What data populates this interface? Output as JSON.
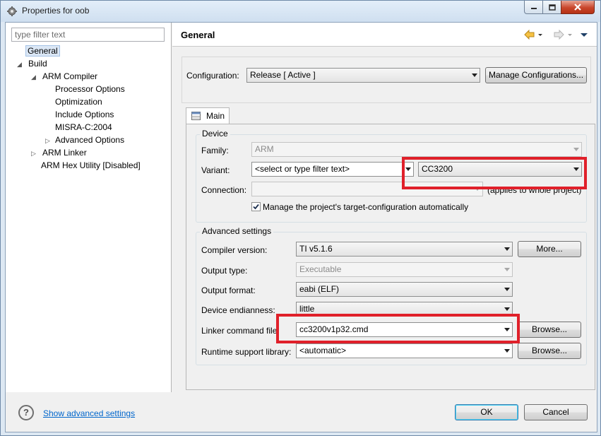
{
  "window": {
    "title": "Properties for oob"
  },
  "left": {
    "filter_placeholder": "type filter text",
    "tree": [
      {
        "label": "General"
      },
      {
        "label": "Build"
      },
      {
        "label": "ARM Compiler"
      },
      {
        "label": "Processor Options"
      },
      {
        "label": "Optimization"
      },
      {
        "label": "Include Options"
      },
      {
        "label": "MISRA-C:2004"
      },
      {
        "label": "Advanced Options"
      },
      {
        "label": "ARM Linker"
      },
      {
        "label": "ARM Hex Utility  [Disabled]"
      }
    ]
  },
  "header": {
    "title": "General"
  },
  "configuration": {
    "label": "Configuration:",
    "value": "Release  [ Active ]",
    "manage_button": "Manage Configurations..."
  },
  "tab": {
    "label": "Main"
  },
  "device": {
    "group_title": "Device",
    "family_label": "Family:",
    "family_value": "ARM",
    "variant_label": "Variant:",
    "variant_filter": "<select or type filter text>",
    "variant_value": "CC3200",
    "connection_label": "Connection:",
    "connection_value": "",
    "connection_note": "(applies to whole project)",
    "manage_checkbox_label": "Manage the project's target-configuration automatically",
    "manage_checked": true
  },
  "advanced": {
    "group_title": "Advanced settings",
    "compiler_label": "Compiler version:",
    "compiler_value": "TI v5.1.6",
    "more_button": "More...",
    "output_type_label": "Output type:",
    "output_type_value": "Executable",
    "output_format_label": "Output format:",
    "output_format_value": "eabi (ELF)",
    "endianness_label": "Device endianness:",
    "endianness_value": "little",
    "linker_label": "Linker command file:",
    "linker_value": "cc3200v1p32.cmd",
    "browse_button": "Browse...",
    "runtime_label": "Runtime support library:",
    "runtime_value": "<automatic>"
  },
  "footer": {
    "help_glyph": "?",
    "show_advanced_link": "Show advanced settings",
    "ok_button": "OK",
    "cancel_button": "Cancel"
  },
  "colors": {
    "highlight_box": "#e0202a",
    "link": "#0066cc"
  }
}
